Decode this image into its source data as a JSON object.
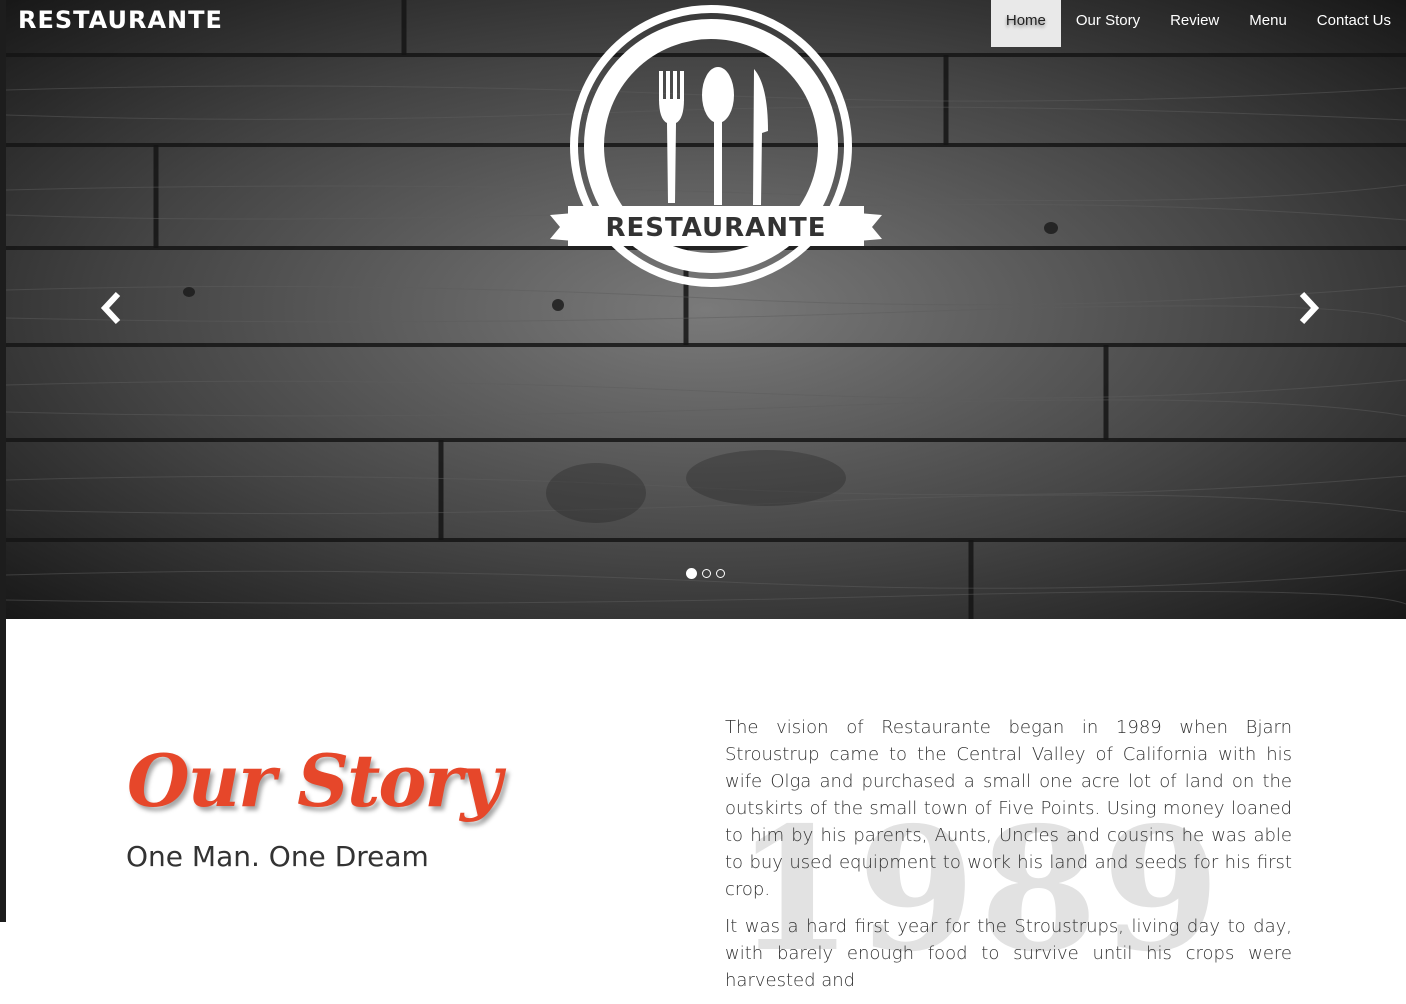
{
  "brand": {
    "name": "RESTAURANTE"
  },
  "nav": {
    "items": [
      {
        "label": "Home",
        "active": true
      },
      {
        "label": "Our Story",
        "active": false
      },
      {
        "label": "Review",
        "active": false
      },
      {
        "label": "Menu",
        "active": false
      },
      {
        "label": "Contact Us",
        "active": false
      }
    ]
  },
  "hero": {
    "logo_text": "RESTAURANTE",
    "prev_icon": "chevron-left-icon",
    "next_icon": "chevron-right-icon",
    "slide_count": 3,
    "active_slide": 1
  },
  "story": {
    "title": "Our Story",
    "subtitle": "One Man. One Dream",
    "year": "1989",
    "paragraphs": [
      "The vision of Restaurante began in 1989 when Bjarn Stroustrup came to the Central Valley of California with his wife Olga and purchased a small one acre lot of land on the outskirts of the small town of Five Points. Using money loaned to him by his parents, Aunts, Uncles and cousins he was able to buy used equipment to work his land and seeds for his first crop.",
      "It was a hard first year for the Stroustrups, living day to day, with barely enough food to survive until his crops were harvested and"
    ]
  },
  "colors": {
    "accent": "#e6472a",
    "hero_bg": "#2b2b2b",
    "nav_active_bg": "#e9e9e9"
  }
}
